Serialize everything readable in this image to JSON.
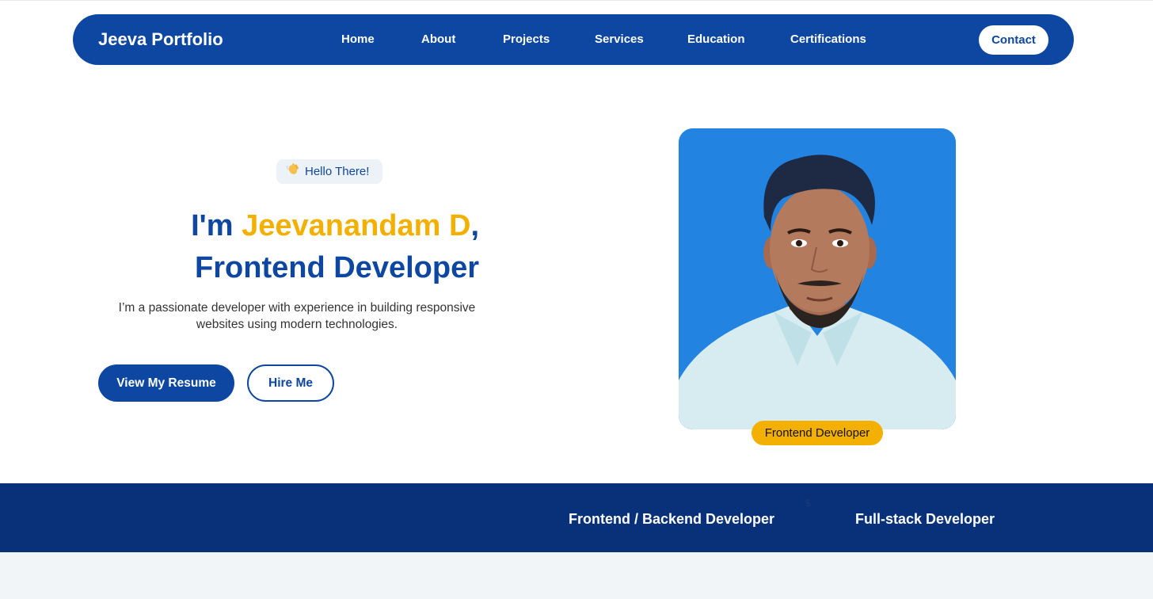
{
  "brand": "Jeeva Portfolio",
  "nav": {
    "items": [
      "Home",
      "About",
      "Projects",
      "Services",
      "Education",
      "Certifications"
    ],
    "contact_label": "Contact"
  },
  "hero": {
    "greeting": "Hello There!",
    "greeting_icon": "waving-hand-icon",
    "title_prefix": "I'm ",
    "title_name": "Jeevanandam D",
    "title_comma": ",",
    "title_role": "Frontend Developer",
    "description": "I’m a passionate developer with experience in building responsive websites using modern technologies.",
    "resume_label": "View My Resume",
    "hire_label": "Hire Me"
  },
  "profile": {
    "role_tag": "Frontend Developer"
  },
  "banner": {
    "items": [
      "Frontend / Backend Developer",
      "Full-stack Developer"
    ],
    "separator": "$"
  },
  "colors": {
    "primary": "#0d47a1",
    "accent": "#f4b000",
    "banner": "#08317a",
    "photo_background": "#2383e0"
  }
}
